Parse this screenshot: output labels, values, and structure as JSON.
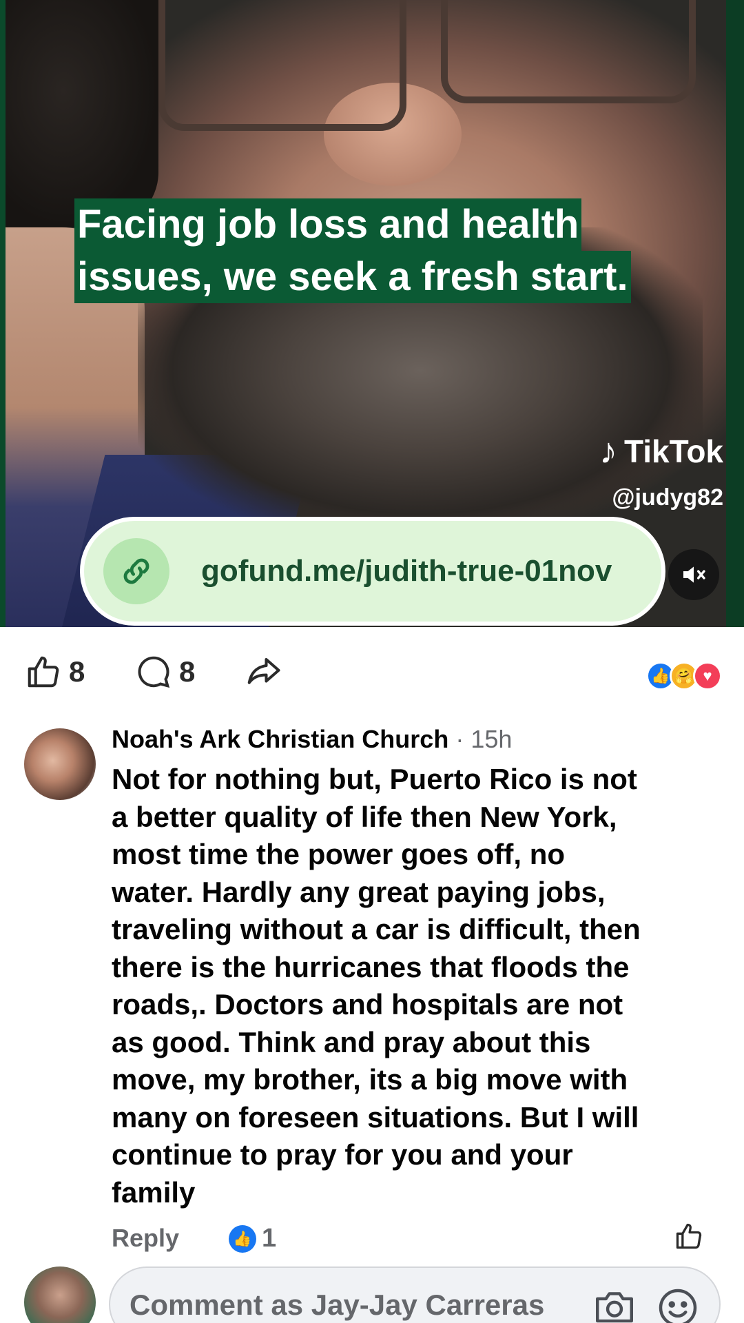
{
  "video": {
    "caption_line1": "Facing job loss and health",
    "caption_line2": "issues, we seek a fresh start.",
    "watermark_brand": "TikTok",
    "watermark_handle": "@judyg82",
    "link_url": "gofund.me/judith-true-01nov",
    "icons": {
      "link": "link-icon",
      "mute": "speaker-muted-icon",
      "brand": "tiktok-note-icon"
    }
  },
  "actions": {
    "like_count": "8",
    "comment_count": "8",
    "reactions": [
      "like",
      "care",
      "love"
    ],
    "colors": {
      "like": "#1877f2",
      "care": "#f7b125",
      "love": "#f33e58"
    }
  },
  "comment": {
    "author": "Noah's Ark Christian Church",
    "time": "· 15h",
    "body_lines": [
      "Not for nothing but, Puerto Rico is not",
      "a better quality of life then New York,",
      "most time the power goes off, no",
      "water. Hardly any great paying jobs,",
      "traveling without a car is difficult, then",
      "there is the hurricanes that floods the",
      "roads,. Doctors and hospitals are not",
      "as good. Think and pray about this",
      "move, my brother, its a big move with",
      "many on foreseen situations. But I will",
      "continue to pray for you and your",
      "family"
    ],
    "reply_label": "Reply",
    "like_count": "1"
  },
  "composer": {
    "placeholder": "Comment as Jay-Jay Carreras"
  }
}
